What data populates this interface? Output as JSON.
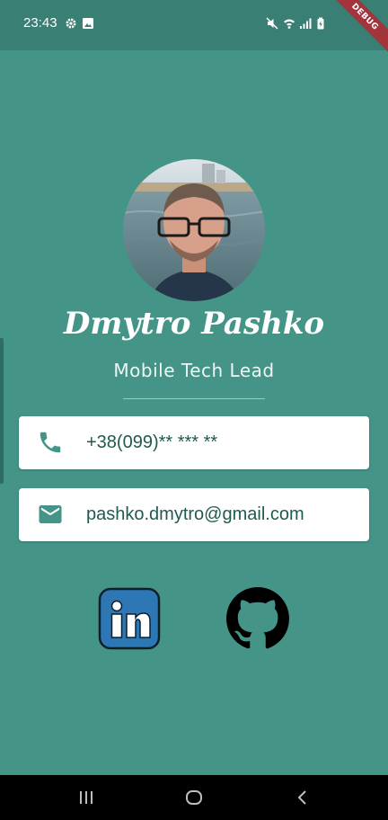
{
  "status_bar": {
    "time": "23:43",
    "icons": [
      "gear-icon",
      "image-icon",
      "mute-icon",
      "wifi-icon",
      "signal-icon",
      "battery-icon"
    ],
    "debug_label": "DEBUG"
  },
  "profile": {
    "name": "Dmytro Pashko",
    "title": "Mobile Tech Lead"
  },
  "contacts": [
    {
      "type": "phone",
      "icon": "phone-icon",
      "value": "+38(099)** *** **"
    },
    {
      "type": "email",
      "icon": "email-icon",
      "value": "pashko.dmytro@gmail.com"
    }
  ],
  "social": [
    {
      "name": "linkedin",
      "icon": "linkedin-icon"
    },
    {
      "name": "github",
      "icon": "github-icon"
    }
  ],
  "colors": {
    "background": "#449587",
    "status_bar": "#3a7f73",
    "card_text": "#1f5a50",
    "accent": "#449587",
    "linkedin": "#2e77b5"
  },
  "nav_bar": {
    "buttons": [
      "recent-apps-icon",
      "home-icon",
      "back-icon"
    ]
  }
}
